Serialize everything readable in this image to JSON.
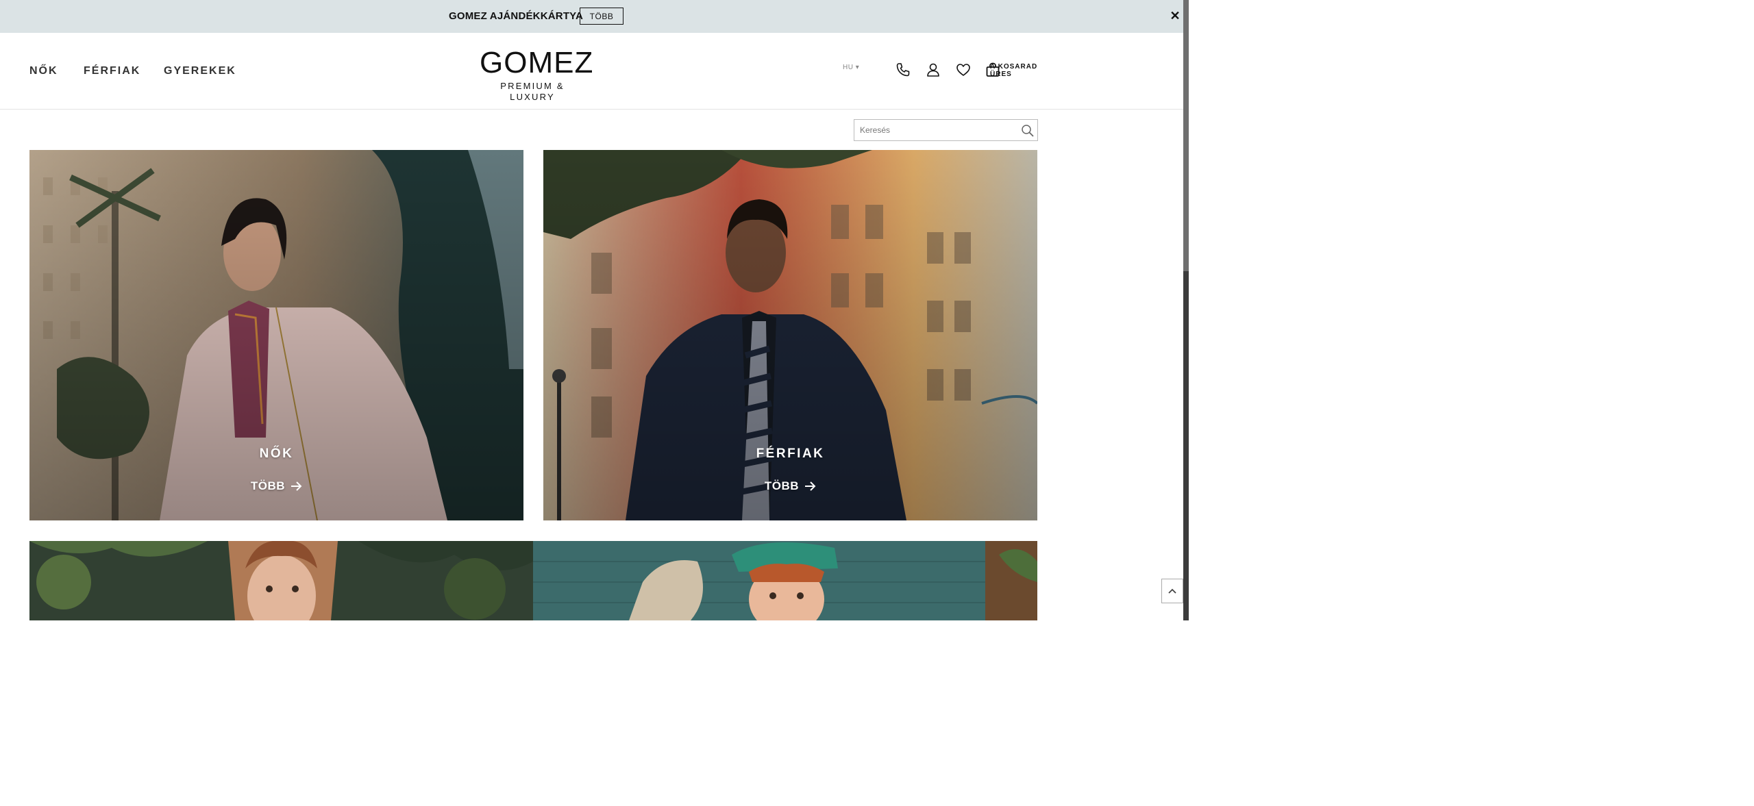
{
  "announcement": {
    "text": "GOMEZ AJÁNDÉKKÁRTYA",
    "button_label": "TÖBB",
    "close_label": "✕"
  },
  "nav": {
    "items": [
      {
        "label": "NŐK"
      },
      {
        "label": "FÉRFIAK"
      },
      {
        "label": "GYEREKEK"
      }
    ]
  },
  "logo": {
    "main": "GOMEZ",
    "sub": "PREMIUM & LUXURY"
  },
  "header": {
    "language": "HU ▾",
    "icons": [
      "phone-icon",
      "account-icon",
      "heart-icon",
      "cart-icon"
    ],
    "cart_line1": "A KOSARAD",
    "cart_line2": "ÜRES"
  },
  "search": {
    "placeholder": "Keresés"
  },
  "tiles": [
    {
      "title": "NŐK",
      "more": "TÖBB"
    },
    {
      "title": "FÉRFIAK",
      "more": "TÖBB"
    }
  ],
  "colors": {
    "announcement_bg": "#dbe3e5",
    "text": "#111111"
  }
}
